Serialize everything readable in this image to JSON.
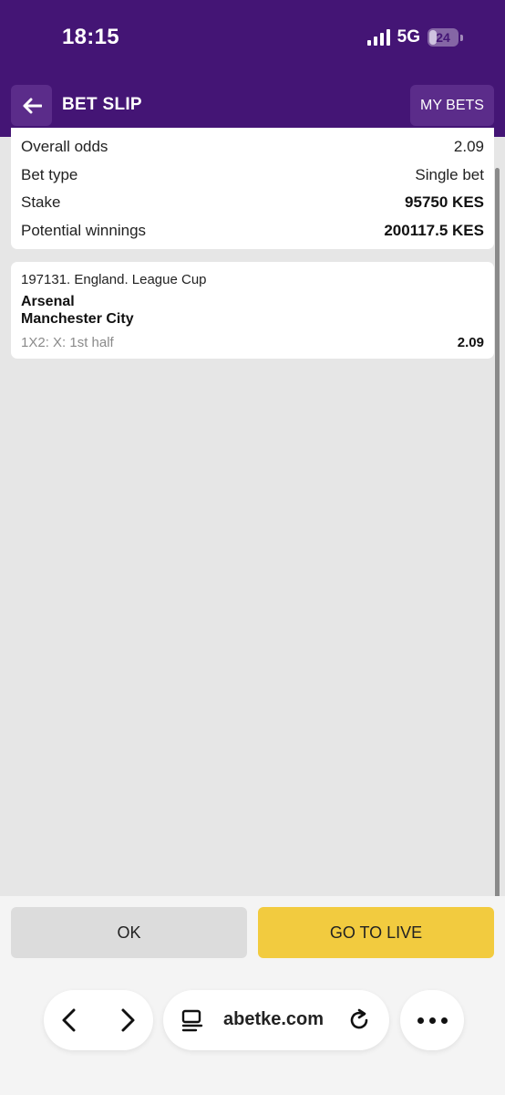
{
  "status_bar": {
    "time": "18:15",
    "network": "5G",
    "battery": "24"
  },
  "header": {
    "title": "BET SLIP",
    "my_bets_label": "MY BETS"
  },
  "summary": [
    {
      "label": "Overall odds",
      "value": "2.09"
    },
    {
      "label": "Bet type",
      "value": "Single bet"
    },
    {
      "label": "Stake",
      "value": "95750 KES"
    },
    {
      "label": "Potential winnings",
      "value": "200117.5 KES"
    }
  ],
  "event": {
    "meta": "197131. England. League Cup",
    "team_home": "Arsenal",
    "team_away": "Manchester City",
    "market": "1X2: X: 1st half",
    "odds": "2.09"
  },
  "actions": {
    "ok_label": "OK",
    "live_label": "GO TO LIVE"
  },
  "browser": {
    "url": "abetke.com"
  },
  "colors": {
    "header": "#441575",
    "accent_button": "#f2cb3f",
    "background": "#e6e6e6"
  }
}
